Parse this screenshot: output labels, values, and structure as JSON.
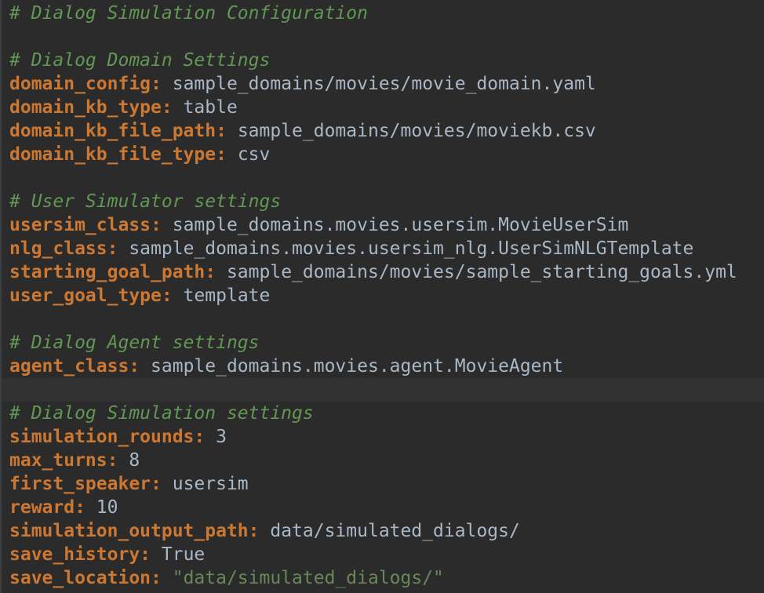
{
  "lines": [
    {
      "type": "comment",
      "text": "# Dialog Simulation Configuration"
    },
    {
      "type": "blank"
    },
    {
      "type": "comment",
      "text": "# Dialog Domain Settings"
    },
    {
      "type": "kv",
      "key": "domain_config",
      "value": "sample_domains/movies/movie_domain.yaml"
    },
    {
      "type": "kv",
      "key": "domain_kb_type",
      "value": "table"
    },
    {
      "type": "kv",
      "key": "domain_kb_file_path",
      "value": "sample_domains/movies/moviekb.csv"
    },
    {
      "type": "kv",
      "key": "domain_kb_file_type",
      "value": "csv"
    },
    {
      "type": "blank"
    },
    {
      "type": "comment",
      "text": "# User Simulator settings"
    },
    {
      "type": "kv",
      "key": "usersim_class",
      "value": "sample_domains.movies.usersim.MovieUserSim"
    },
    {
      "type": "kv",
      "key": "nlg_class",
      "value": "sample_domains.movies.usersim_nlg.UserSimNLGTemplate"
    },
    {
      "type": "kv",
      "key": "starting_goal_path",
      "value": "sample_domains/movies/sample_starting_goals.yml"
    },
    {
      "type": "kv",
      "key": "user_goal_type",
      "value": "template"
    },
    {
      "type": "blank"
    },
    {
      "type": "comment",
      "text": "# Dialog Agent settings"
    },
    {
      "type": "kv",
      "key": "agent_class",
      "value": "sample_domains.movies.agent.MovieAgent"
    },
    {
      "type": "blank",
      "current": true
    },
    {
      "type": "comment",
      "text": "# Dialog Simulation settings"
    },
    {
      "type": "kv",
      "key": "simulation_rounds",
      "value": "3"
    },
    {
      "type": "kv",
      "key": "max_turns",
      "value": "8"
    },
    {
      "type": "kv",
      "key": "first_speaker",
      "value": "usersim"
    },
    {
      "type": "kv",
      "key": "reward",
      "value": "10"
    },
    {
      "type": "kv",
      "key": "simulation_output_path",
      "value": "data/simulated_dialogs/"
    },
    {
      "type": "kv",
      "key": "save_history",
      "value": "True"
    },
    {
      "type": "kv",
      "key": "save_location",
      "value": "\"data/simulated_dialogs/\"",
      "string": true
    }
  ],
  "colors": {
    "background": "#2b2b2b",
    "current_line": "#323232",
    "comment": "#629755",
    "key": "#cc7832",
    "value": "#a9b7c6",
    "string": "#6a8759"
  }
}
